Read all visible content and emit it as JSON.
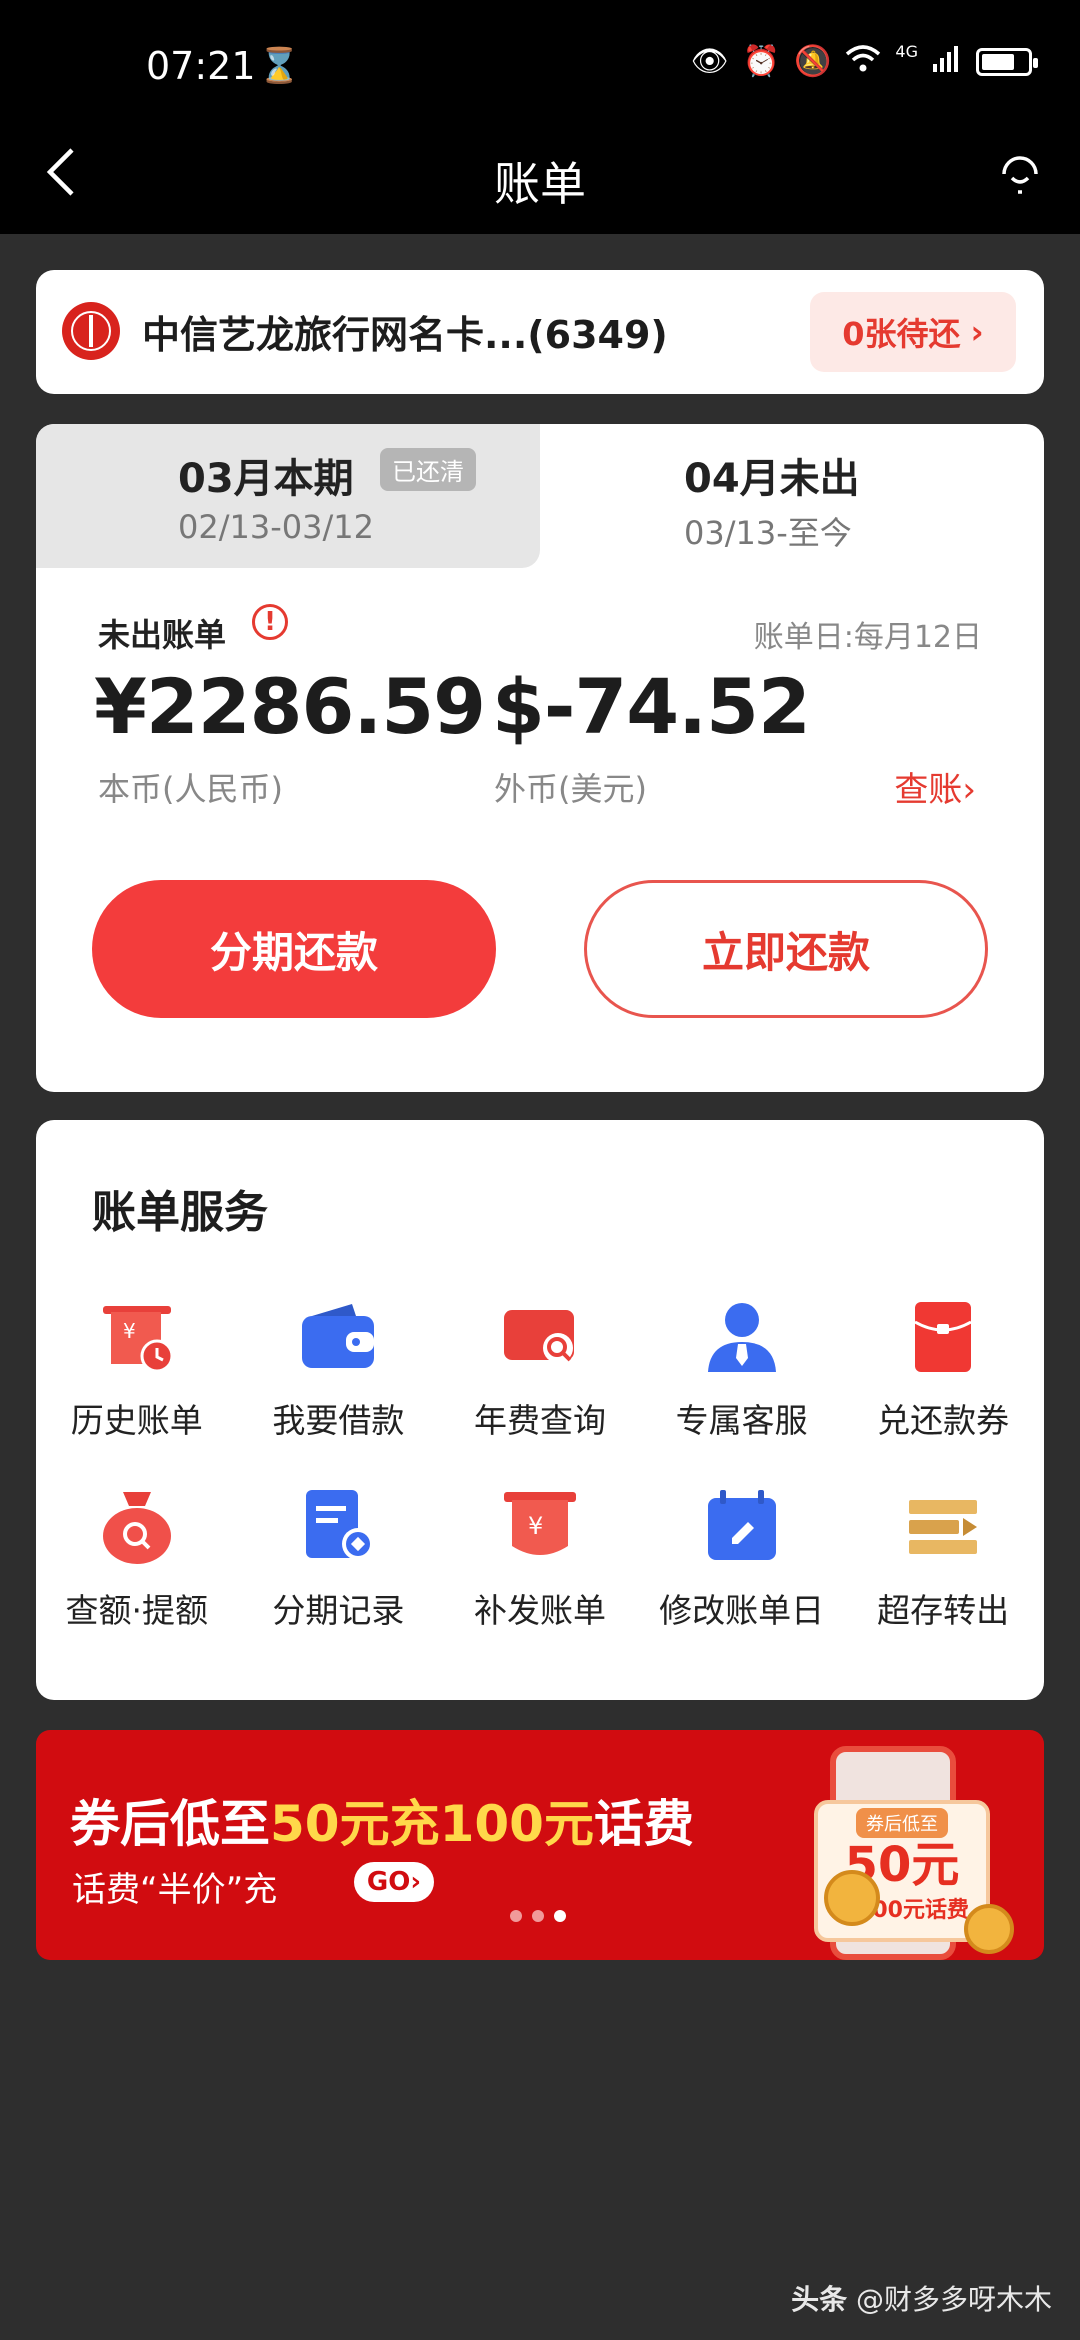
{
  "status_bar": {
    "time": "07:21",
    "network": "4G"
  },
  "header": {
    "title": "账单"
  },
  "account": {
    "bank_card": "中信艺龙旅行网名卡...(6349)",
    "pending": "0张待还",
    "pending_arrow": "›"
  },
  "bill_tabs": [
    {
      "title": "03月本期",
      "badge": "已还清",
      "period": "02/13-03/12"
    },
    {
      "title": "04月未出",
      "period": "03/13-至今"
    }
  ],
  "bill": {
    "label": "未出账单",
    "info_mark": "!",
    "bill_day": "账单日:每月12日",
    "amount_cny": "¥2286.59",
    "currency_cny": "本币(人民币)",
    "amount_usd": "$-74.52",
    "currency_usd": "外币(美元)",
    "check_link": "查账›",
    "installment_button": "分期还款",
    "pay_now_button": "立即还款"
  },
  "services": {
    "title": "账单服务",
    "items": [
      {
        "label": "历史账单",
        "icon": "history-bill-icon"
      },
      {
        "label": "我要借款",
        "icon": "wallet-icon"
      },
      {
        "label": "年费查询",
        "icon": "annual-fee-search-icon"
      },
      {
        "label": "专属客服",
        "icon": "customer-service-icon"
      },
      {
        "label": "兑还款券",
        "icon": "red-envelope-icon"
      },
      {
        "label": "查额·提额",
        "icon": "credit-limit-icon"
      },
      {
        "label": "分期记录",
        "icon": "installment-record-icon"
      },
      {
        "label": "补发账单",
        "icon": "reissue-bill-icon"
      },
      {
        "label": "修改账单日",
        "icon": "calendar-edit-icon"
      },
      {
        "label": "超存转出",
        "icon": "overpay-transfer-icon"
      }
    ]
  },
  "banner": {
    "line1_a": "券后低至",
    "line1_b": "50元充100元",
    "line1_c": "话费",
    "line2": "话费“半价”充",
    "go": "GO›",
    "coupon_tag": "券后低至",
    "coupon_amount": "50元",
    "coupon_desc": "充100元话费"
  },
  "watermark": {
    "source": "头条",
    "author": "@财多多呀木木"
  },
  "colors": {
    "accent": "#f33c3c",
    "banner": "#d10c10",
    "background": "#2e2e2e"
  }
}
